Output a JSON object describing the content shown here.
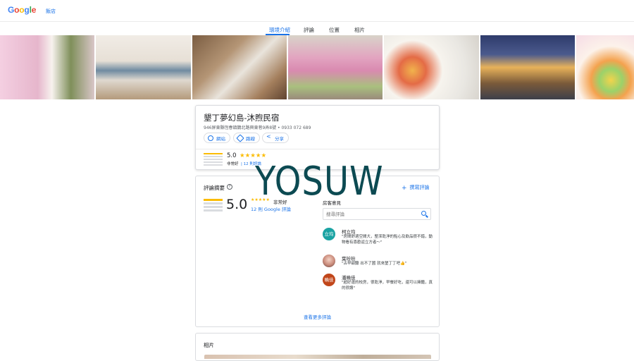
{
  "header": {
    "logo": "Google",
    "breadcrumb": "飯店"
  },
  "tabs": [
    {
      "label": "環境介紹",
      "active": true
    },
    {
      "label": "評論",
      "active": false
    },
    {
      "label": "位置",
      "active": false
    },
    {
      "label": "相片",
      "active": false
    }
  ],
  "business": {
    "name": "墾丁夢幻島-沐煦民宿",
    "address": "946屏東縣恆春鎮鵝北路興東巷9弄8號 • 0933 072 689",
    "buttons": {
      "website": "網站",
      "directions": "路線",
      "share": "分享"
    },
    "rating": "5.0",
    "rating_label": "非常好",
    "review_count": "12 則評論"
  },
  "review_summary": {
    "title": "評論摘要",
    "help": "?",
    "write_review": "撰寫評論",
    "score": "5.0",
    "stars": "★★★★★",
    "score_label": "非常好",
    "google_reviews": "12 則 Google 評論",
    "guest_title": "房客意見",
    "search_placeholder": "搜尋評論",
    "more": "查看更多評論"
  },
  "reviews": [
    {
      "name": "柯立均",
      "avatar_text": "立均",
      "avatar_color": "#1aa3a3",
      "text": "\"房間舒適空間大，整潔乾淨的點心及飲品很不錯，動物看有喜歡返立方者～\""
    },
    {
      "name": "葉玢玢",
      "avatar_text": "",
      "avatar_color": "#e2a0a0",
      "text": "\"古早甜聽 出不了國 就來墾丁丁吧👍\""
    },
    {
      "name": "潘曉佳",
      "avatar_text": "曉佳",
      "avatar_color": "#c1461a",
      "text": "\"超好運的校房，很乾淨，早餐好吃，還可以擁豔，真的很讚\""
    }
  ],
  "photos_section": {
    "title": "相片"
  },
  "watermark": "YOSUW",
  "colors": {
    "accent": "#1a73e8",
    "star": "#fbbc04"
  }
}
